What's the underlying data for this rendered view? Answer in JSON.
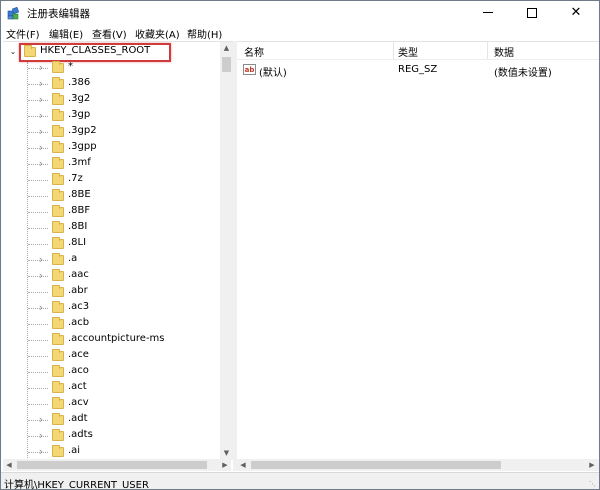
{
  "window": {
    "title": "注册表编辑器",
    "controls": {
      "minimize": "",
      "maximize": "",
      "close": "✕"
    }
  },
  "menu": [
    "文件(F)",
    "编辑(E)",
    "查看(V)",
    "收藏夹(A)",
    "帮助(H)"
  ],
  "tree": {
    "root": {
      "label": "HKEY_CLASSES_ROOT",
      "expanded": true,
      "highlighted": true
    },
    "items": [
      {
        "label": "*",
        "expandable": true
      },
      {
        "label": ".386",
        "expandable": true
      },
      {
        "label": ".3g2",
        "expandable": true
      },
      {
        "label": ".3gp",
        "expandable": true
      },
      {
        "label": ".3gp2",
        "expandable": true
      },
      {
        "label": ".3gpp",
        "expandable": true
      },
      {
        "label": ".3mf",
        "expandable": true
      },
      {
        "label": ".7z",
        "expandable": false
      },
      {
        "label": ".8BE",
        "expandable": false
      },
      {
        "label": ".8BF",
        "expandable": false
      },
      {
        "label": ".8BI",
        "expandable": false
      },
      {
        "label": ".8LI",
        "expandable": false
      },
      {
        "label": ".a",
        "expandable": true
      },
      {
        "label": ".aac",
        "expandable": true
      },
      {
        "label": ".abr",
        "expandable": false
      },
      {
        "label": ".ac3",
        "expandable": true
      },
      {
        "label": ".acb",
        "expandable": false
      },
      {
        "label": ".accountpicture-ms",
        "expandable": false
      },
      {
        "label": ".ace",
        "expandable": false
      },
      {
        "label": ".aco",
        "expandable": false
      },
      {
        "label": ".act",
        "expandable": false
      },
      {
        "label": ".acv",
        "expandable": false
      },
      {
        "label": ".adt",
        "expandable": true
      },
      {
        "label": ".adts",
        "expandable": true
      },
      {
        "label": ".ai",
        "expandable": true
      }
    ]
  },
  "values_pane": {
    "columns": [
      "名称",
      "类型",
      "数据"
    ],
    "rows": [
      {
        "icon": "ab",
        "name": "(默认)",
        "type": "REG_SZ",
        "data": "(数值未设置)"
      }
    ]
  },
  "status": {
    "path": "计算机\\HKEY_CURRENT_USER"
  },
  "colors": {
    "highlight_border": "#d23b3b",
    "folder": "#f4d775"
  }
}
